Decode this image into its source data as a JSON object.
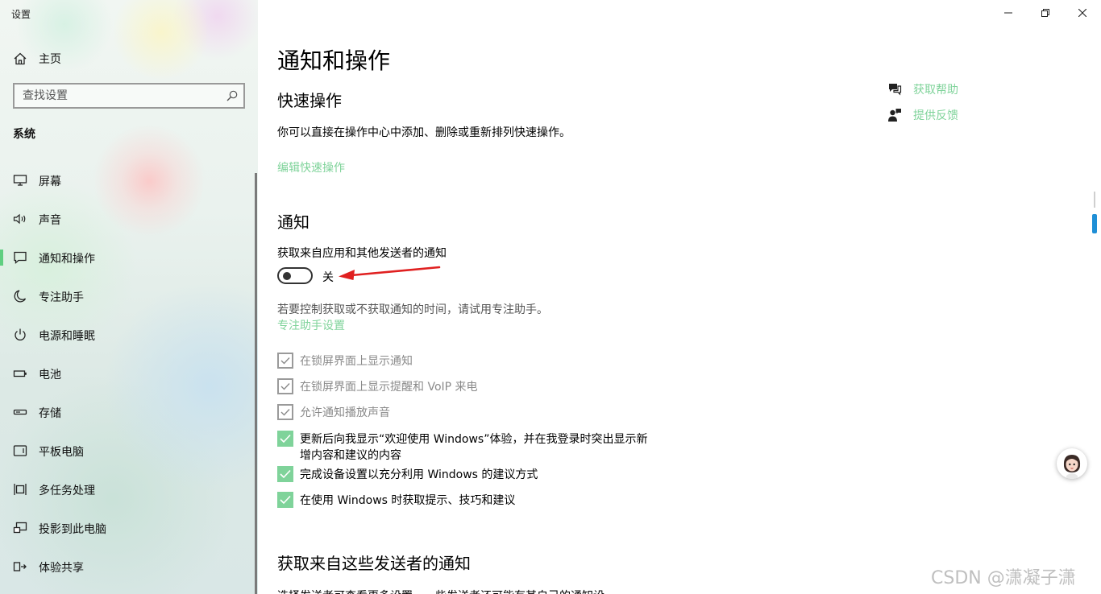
{
  "window": {
    "title": "设置",
    "controls": [
      "minimize",
      "restore",
      "close"
    ]
  },
  "sidebar": {
    "home_label": "主页",
    "search": {
      "placeholder": "查找设置"
    },
    "section_title": "系统",
    "items": [
      {
        "label": "屏幕",
        "icon": "monitor-icon"
      },
      {
        "label": "声音",
        "icon": "speaker-icon"
      },
      {
        "label": "通知和操作",
        "icon": "message-icon",
        "active": true
      },
      {
        "label": "专注助手",
        "icon": "moon-icon"
      },
      {
        "label": "电源和睡眠",
        "icon": "power-icon"
      },
      {
        "label": "电池",
        "icon": "battery-icon"
      },
      {
        "label": "存储",
        "icon": "storage-icon"
      },
      {
        "label": "平板电脑",
        "icon": "tablet-icon"
      },
      {
        "label": "多任务处理",
        "icon": "multitask-icon"
      },
      {
        "label": "投影到此电脑",
        "icon": "project-icon"
      },
      {
        "label": "体验共享",
        "icon": "share-icon"
      }
    ]
  },
  "main": {
    "title": "通知和操作",
    "quick_actions": {
      "heading": "快速操作",
      "description": "你可以直接在操作中心中添加、删除或重新排列快速操作。",
      "edit_link": "编辑快速操作"
    },
    "notifications": {
      "heading": "通知",
      "toggle_label": "获取来自应用和其他发送者的通知",
      "toggle_state": "关",
      "toggle_on": false,
      "focus_hint": "若要控制获取或不获取通知的时间，请试用专注助手。",
      "focus_link": "专注助手设置",
      "checkboxes": [
        {
          "label": "在锁屏界面上显示通知",
          "checked": true,
          "disabled": true
        },
        {
          "label": "在锁屏界面上显示提醒和 VoIP 来电",
          "checked": true,
          "disabled": true
        },
        {
          "label": "允许通知播放声音",
          "checked": true,
          "disabled": true
        },
        {
          "label": "更新后向我显示“欢迎使用 Windows”体验，并在我登录时突出显示新增内容和建议的内容",
          "checked": true,
          "disabled": false
        },
        {
          "label": "完成设备设置以充分利用 Windows 的建议方式",
          "checked": true,
          "disabled": false
        },
        {
          "label": "在使用 Windows 时获取提示、技巧和建议",
          "checked": true,
          "disabled": false
        }
      ]
    },
    "senders": {
      "heading": "获取来自这些发送者的通知",
      "description": "选择发送者可查看更多设置。一些发送者还可能有其自己的通知设"
    }
  },
  "help": {
    "get_help": "获取帮助",
    "feedback": "提供反馈"
  },
  "watermark": "CSDN @潇凝子潇",
  "colors": {
    "accent": "#7fd39a",
    "active_indicator": "#5fcf80",
    "arrow": "#e02020",
    "scroll_thumb": "#1f8fd6"
  }
}
